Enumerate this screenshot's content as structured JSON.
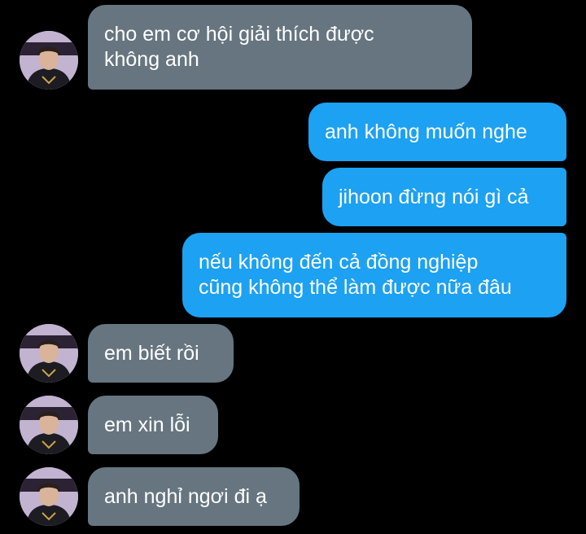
{
  "colors": {
    "background": "#000000",
    "incoming_bubble": "#66757f",
    "outgoing_bubble": "#1da1f2",
    "text": "#ffffff"
  },
  "messages": [
    {
      "direction": "incoming",
      "lines": [
        "cho em cơ hội giải thích được",
        "không anh"
      ]
    },
    {
      "direction": "outgoing",
      "lines": [
        "anh không muốn nghe"
      ]
    },
    {
      "direction": "outgoing",
      "lines": [
        "jihoon đừng nói gì cả"
      ]
    },
    {
      "direction": "outgoing",
      "lines": [
        "nếu không đến cả đồng nghiệp",
        "cũng không thể làm được nữa đâu"
      ]
    },
    {
      "direction": "incoming",
      "lines": [
        "em biết rồi"
      ]
    },
    {
      "direction": "incoming",
      "lines": [
        "em xin lỗi"
      ]
    },
    {
      "direction": "incoming",
      "lines": [
        "anh nghỉ ngơi đi ạ"
      ]
    }
  ]
}
